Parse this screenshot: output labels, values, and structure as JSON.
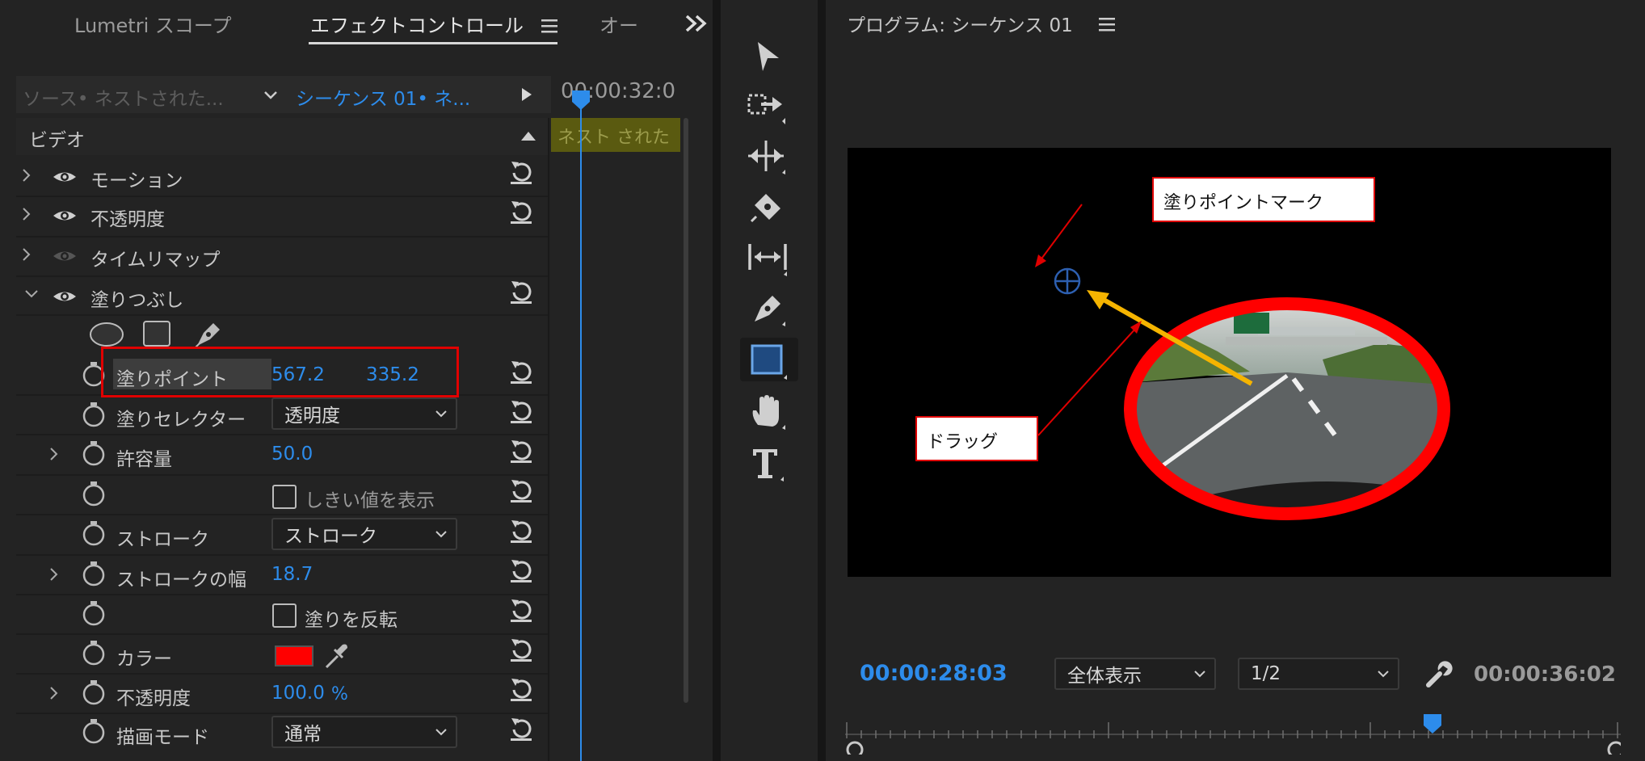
{
  "left_panel": {
    "tabs": [
      "Lumetri スコープ",
      "エフェクトコントロール",
      "オー"
    ],
    "overflow": "»",
    "source_label": "ソース• ネストされた...",
    "sequence_label": "シーケンス 01• ネ...",
    "timecode": "00:00:32:0",
    "clip_label": "ネスト された",
    "section_label": "ビデオ",
    "effects": [
      {
        "label": "モーション"
      },
      {
        "label": "不透明度"
      },
      {
        "label": "タイムリマップ"
      },
      {
        "label": "塗りつぶし"
      }
    ],
    "params": {
      "fill_point": {
        "label": "塗りポイント",
        "x": "567.2",
        "y": "335.2"
      },
      "fill_selector": {
        "label": "塗りセレクター",
        "value": "透明度"
      },
      "tolerance": {
        "label": "許容量",
        "value": "50.0"
      },
      "threshold": {
        "label": "しきい値を表示"
      },
      "stroke": {
        "label": "ストローク",
        "value": "ストローク"
      },
      "stroke_width": {
        "label": "ストロークの幅",
        "value": "18.7"
      },
      "invert": {
        "label": "塗りを反転"
      },
      "color": {
        "label": "カラー",
        "swatch": "#ff0000"
      },
      "opacity": {
        "label": "不透明度",
        "value": "100.0",
        "unit": "%"
      },
      "blend_mode": {
        "label": "描画モード",
        "value": "通常"
      }
    }
  },
  "tools": [
    "selection-tool",
    "track-select-tool",
    "ripple-edit-tool",
    "razor-tool",
    "slip-tool",
    "pen-tool",
    "rectangle-tool",
    "hand-tool",
    "type-tool"
  ],
  "program_monitor": {
    "title": "プログラム: シーケンス 01",
    "current_timecode": "00:00:28:03",
    "zoom": "全体表示",
    "resolution": "1/2",
    "duration": "00:00:36:02",
    "callout_fill_point": "塗りポイントマーク",
    "callout_drag": "ドラッグ"
  },
  "colors": {
    "accent": "#2d8ceb",
    "annotation_red": "#e00000",
    "arrow": "#f5b400",
    "clip": "#5a5a10"
  }
}
